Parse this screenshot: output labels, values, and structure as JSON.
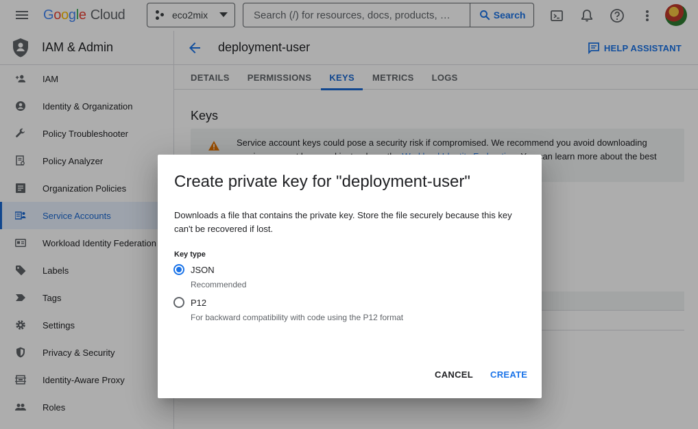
{
  "topbar": {
    "logo_letters": [
      "G",
      "o",
      "o",
      "g",
      "l",
      "e"
    ],
    "logo_product": "Cloud",
    "project_name": "eco2mix",
    "search_placeholder": "Search (/) for resources, docs, products, …",
    "search_button": "Search",
    "icons": [
      "cloud-shell-icon",
      "notifications-icon",
      "help-icon",
      "more-vert-icon"
    ]
  },
  "sidebar": {
    "title": "IAM & Admin",
    "items": [
      {
        "label": "IAM",
        "icon": "person-add-icon"
      },
      {
        "label": "Identity & Organization",
        "icon": "account-circle-icon"
      },
      {
        "label": "Policy Troubleshooter",
        "icon": "wrench-icon"
      },
      {
        "label": "Policy Analyzer",
        "icon": "document-search-icon"
      },
      {
        "label": "Organization Policies",
        "icon": "list-document-icon"
      },
      {
        "label": "Service Accounts",
        "icon": "service-account-icon",
        "active": true
      },
      {
        "label": "Workload Identity Federation",
        "icon": "id-card-icon"
      },
      {
        "label": "Labels",
        "icon": "label-icon"
      },
      {
        "label": "Tags",
        "icon": "tag-icon"
      },
      {
        "label": "Settings",
        "icon": "gear-icon"
      },
      {
        "label": "Privacy & Security",
        "icon": "shield-icon"
      },
      {
        "label": "Identity-Aware Proxy",
        "icon": "proxy-icon"
      },
      {
        "label": "Roles",
        "icon": "roles-icon"
      }
    ]
  },
  "main": {
    "page_title": "deployment-user",
    "help_assistant": "HELP ASSISTANT",
    "tabs": [
      "DETAILS",
      "PERMISSIONS",
      "KEYS",
      "METRICS",
      "LOGS"
    ],
    "active_tab": "KEYS",
    "section_title": "Keys",
    "warning": {
      "text_1": "Service account keys could pose a security risk if compromised. We recommend you avoid downloading service account keys and instead use the ",
      "link": "Workload Identity Federation",
      "text_2": ". You can learn more about the best"
    }
  },
  "dialog": {
    "title": "Create private key for \"deployment-user\"",
    "description": "Downloads a file that contains the private key. Store the file securely because this key can't be recovered if lost.",
    "key_type_label": "Key type",
    "options": [
      {
        "label": "JSON",
        "sub": "Recommended",
        "checked": true
      },
      {
        "label": "P12",
        "sub": "For backward compatibility with code using the P12 format",
        "checked": false
      }
    ],
    "cancel": "CANCEL",
    "create": "CREATE"
  },
  "colors": {
    "accent": "#1a73e8",
    "active_nav_bg": "#e8f0fe",
    "warning_icon": "#e37400",
    "scrim": "rgba(0,0,0,0.32)"
  }
}
